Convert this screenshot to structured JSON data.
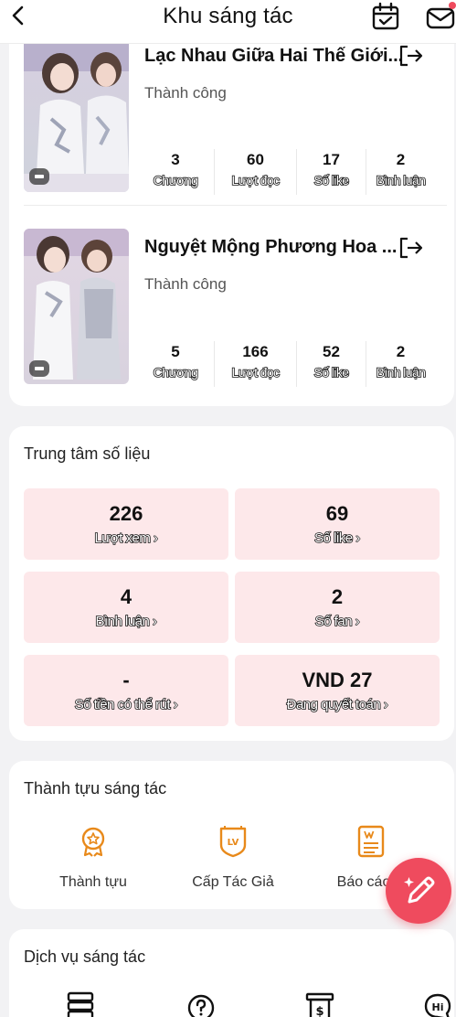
{
  "header": {
    "title": "Khu sáng tác"
  },
  "works": [
    {
      "title": "Lạc Nhau Giữa Hai Thế Giới...",
      "status": "Thành công",
      "stats": [
        {
          "value": "3",
          "label": "Chương"
        },
        {
          "value": "60",
          "label": "Lượt đọc"
        },
        {
          "value": "17",
          "label": "Số like"
        },
        {
          "value": "2",
          "label": "Bình luận"
        }
      ]
    },
    {
      "title": "Nguyệt Mộng Phương Hoa ...",
      "status": "Thành công",
      "stats": [
        {
          "value": "5",
          "label": "Chương"
        },
        {
          "value": "166",
          "label": "Lượt đọc"
        },
        {
          "value": "52",
          "label": "Số like"
        },
        {
          "value": "2",
          "label": "Bình luận"
        }
      ]
    }
  ],
  "data_center": {
    "title": "Trung tâm số liệu",
    "tiles": [
      {
        "value": "226",
        "label": "Lượt xem"
      },
      {
        "value": "69",
        "label": "Số like"
      },
      {
        "value": "4",
        "label": "Bình luận"
      },
      {
        "value": "2",
        "label": "Số fan"
      },
      {
        "value": "-",
        "label": "Số tiền có thể rút"
      },
      {
        "value": "VND 27",
        "label": "Đang quyết toán"
      }
    ],
    "chevron": "›"
  },
  "achievements": {
    "title": "Thành tựu sáng tác",
    "items": [
      {
        "label": "Thành tựu",
        "icon": "medal-icon"
      },
      {
        "label": "Cấp Tác Giả",
        "icon": "level-badge-icon"
      },
      {
        "label": "Báo cáo vi",
        "icon": "report-icon"
      }
    ]
  },
  "services": {
    "title": "Dịch vụ sáng tác",
    "icons": [
      "server-icon",
      "help-icon",
      "payment-icon",
      "hi-chat-icon"
    ]
  },
  "colors": {
    "accent": "#ef4b5e",
    "tile_bg": "#fde8ea",
    "icon_orange": "#e8891a"
  }
}
